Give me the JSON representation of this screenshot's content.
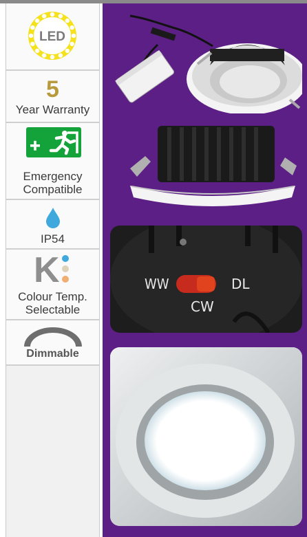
{
  "features": {
    "led": {
      "icon": "led-ring-icon",
      "text": "LED"
    },
    "warranty": {
      "number": "5",
      "label": "Year Warranty"
    },
    "emergency": {
      "icon": "emergency-exit-icon",
      "label_line1": "Emergency",
      "label_line2": "Compatible"
    },
    "ip": {
      "icon": "water-drop-icon",
      "label": "IP54"
    },
    "colour": {
      "icon": "kelvin-icon",
      "letter": "K",
      "label_line1": "Colour Temp.",
      "label_line2": "Selectable"
    },
    "dimmable": {
      "icon": "dimmer-arc-icon",
      "label": "Dimmable"
    }
  },
  "photos": {
    "switch": {
      "ww": "WW",
      "dl": "DL",
      "cw": "CW"
    }
  },
  "colors": {
    "purple": "#5c1f85",
    "gold": "#b89a3d",
    "led_yellow": "#f5e21c",
    "emergency_green": "#14a33b",
    "drop_blue": "#3fa9dd"
  }
}
